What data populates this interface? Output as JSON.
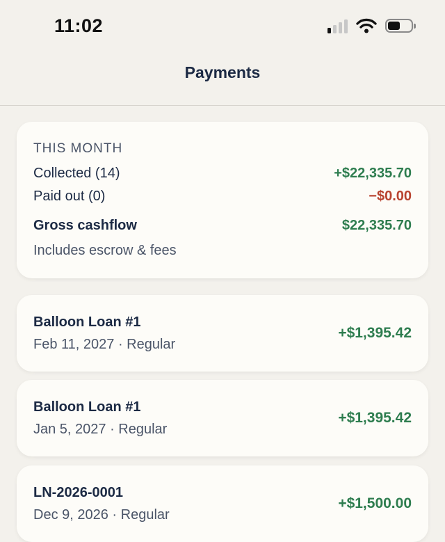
{
  "status_bar": {
    "time": "11:02",
    "battery_level": 0.5,
    "signal_bars": 1,
    "signal_icon": "cellular-signal-icon",
    "wifi_icon": "wifi-icon",
    "battery_icon": "battery-icon"
  },
  "nav": {
    "title": "Payments"
  },
  "summary": {
    "heading": "THIS MONTH",
    "collected_label": "Collected (14)",
    "collected_amount": "+$22,335.70",
    "paid_out_label": "Paid out (0)",
    "paid_out_amount": "−$0.00",
    "gross_label": "Gross cashflow",
    "gross_amount": "$22,335.70",
    "note": "Includes escrow & fees"
  },
  "payments": [
    {
      "name": "Balloon Loan #1",
      "meta": "Feb 11, 2027 · Regular",
      "amount": "+$1,395.42"
    },
    {
      "name": "Balloon Loan #1",
      "meta": "Jan 5, 2027 · Regular",
      "amount": "+$1,395.42"
    },
    {
      "name": "LN-2026-0001",
      "meta": "Dec 9, 2026 · Regular",
      "amount": "+$1,500.00"
    }
  ],
  "colors": {
    "positive": "#2e7d4f",
    "negative": "#b8432f",
    "background": "#f3f1ec",
    "card": "#fdfcf8",
    "text": "#1c2a44"
  }
}
